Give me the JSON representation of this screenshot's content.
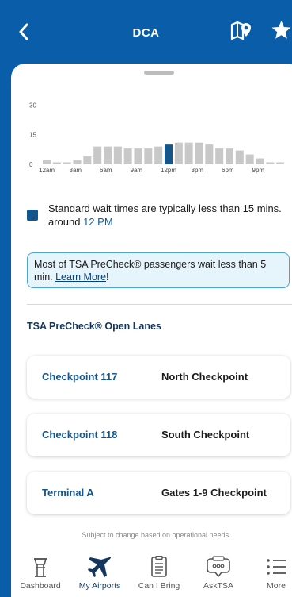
{
  "header": {
    "title": "DCA",
    "back_icon": "chevron-left-icon",
    "map_icon": "map-pin-icon",
    "favorite_icon": "star-icon"
  },
  "chart_data": {
    "type": "bar",
    "title": "",
    "xlabel": "",
    "ylabel": "",
    "ylim": [
      0,
      35
    ],
    "yticks": [
      "0",
      "15",
      "30"
    ],
    "xtick_labels": [
      "12am",
      "3am",
      "6am",
      "9am",
      "12pm",
      "3pm",
      "6pm",
      "9pm"
    ],
    "categories": [
      "12am",
      "1am",
      "2am",
      "3am",
      "4am",
      "5am",
      "6am",
      "7am",
      "8am",
      "9am",
      "10am",
      "11am",
      "12pm",
      "1pm",
      "2pm",
      "3pm",
      "4pm",
      "5pm",
      "6pm",
      "7pm",
      "8pm",
      "9pm",
      "10pm",
      "11pm"
    ],
    "values": [
      2,
      1,
      1,
      2,
      4,
      9,
      9,
      9,
      8,
      8,
      8,
      9,
      10,
      11,
      11,
      11,
      10,
      8,
      8,
      7,
      5,
      3,
      1,
      1
    ],
    "highlight_index": 12,
    "colors": {
      "bar": "#c8c8c8",
      "highlight": "#14568c"
    }
  },
  "legend": {
    "text_before": "Standard wait times are typically less than 15 mins. around ",
    "time": "12 PM"
  },
  "precheck_notice": {
    "text": "Most of TSA PreCheck® passengers wait less than 5 min. ",
    "link": "Learn More",
    "suffix": "!"
  },
  "section_title": "TSA PreCheck® Open Lanes",
  "lanes": [
    {
      "name": "Checkpoint 117",
      "location": "North Checkpoint"
    },
    {
      "name": "Checkpoint 118",
      "location": "South Checkpoint"
    },
    {
      "name": "Terminal A",
      "location": "Gates 1-9 Checkpoint"
    }
  ],
  "footnote": "Subject to change based on operational needs.",
  "tabs": [
    {
      "label": "Dashboard",
      "icon": "airport-tower-icon"
    },
    {
      "label": "My Airports",
      "icon": "airplane-icon",
      "active": true
    },
    {
      "label": "Can I Bring",
      "icon": "document-icon"
    },
    {
      "label": "AskTSA",
      "icon": "chat-bubble-icon"
    },
    {
      "label": "More",
      "icon": "menu-list-icon"
    }
  ]
}
